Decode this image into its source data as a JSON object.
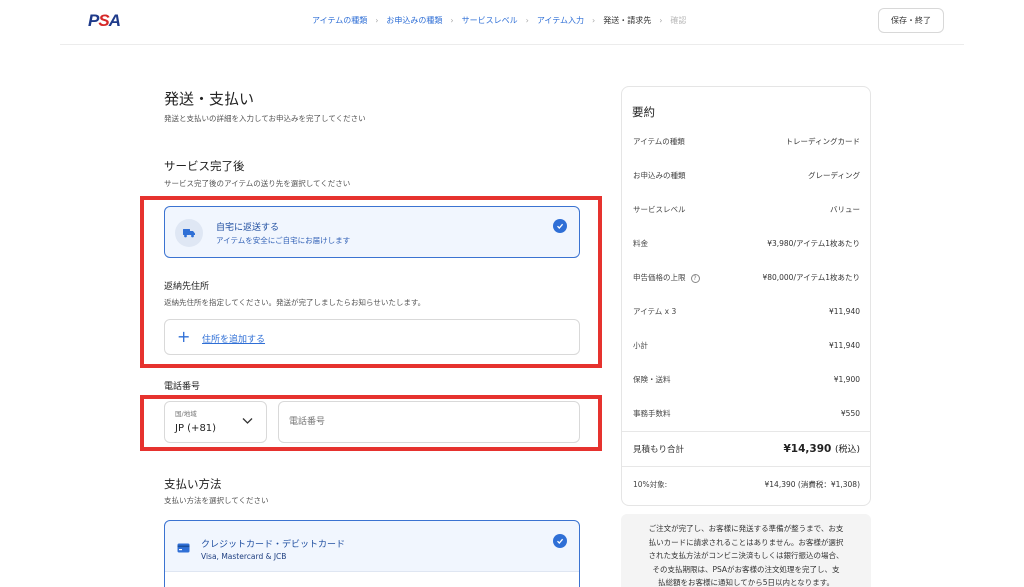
{
  "header": {
    "logo": {
      "p": "P",
      "s": "S",
      "a": "A"
    },
    "breadcrumbs": [
      {
        "label": "アイテムの種類"
      },
      {
        "label": "お申込みの種類"
      },
      {
        "label": "サービスレベル"
      },
      {
        "label": "アイテム入力"
      },
      {
        "label": "発送・請求先"
      },
      {
        "label": "確認"
      }
    ],
    "save_label": "保存・終了"
  },
  "main": {
    "title": "発送・支払い",
    "subtitle": "発送と支払いの詳細を入力してお申込みを完了してください",
    "service_section": {
      "title": "サービス完了後",
      "subtitle": "サービス完了後のアイテムの送り先を選択してください",
      "option": {
        "title": "自宅に返送する",
        "subtitle": "アイテムを安全にご自宅にお届けします",
        "icon": "truck-icon"
      }
    },
    "return_address": {
      "title": "返納先住所",
      "subtitle": "返納先住所を指定してください。発送が完了しましたらお知らせいたします。",
      "add_label": "住所を追加する"
    },
    "phone": {
      "label": "電話番号",
      "country_label": "国/地域",
      "country_value": "JP (+81)",
      "placeholder": "電話番号"
    },
    "payment_section": {
      "title": "支払い方法",
      "subtitle": "支払い方法を選択してください",
      "option": {
        "title": "クレジットカード・デビットカード",
        "subtitle": "Visa, Mastercard & JCB",
        "icon": "credit-card-icon"
      }
    }
  },
  "summary": {
    "title": "要約",
    "rows": [
      {
        "label": "アイテムの種類",
        "value": "トレーディングカード"
      },
      {
        "label": "お申込みの種類",
        "value": "グレーディング"
      },
      {
        "label": "サービスレベル",
        "value": "バリュー"
      },
      {
        "label": "料金",
        "value": "¥3,980/アイテム1枚あたり"
      },
      {
        "label": "申告価格の上限",
        "value": "¥80,000/アイテム1枚あたり"
      },
      {
        "label": "アイテム x 3",
        "value": "¥11,940"
      },
      {
        "label": "小計",
        "value": "¥11,940"
      },
      {
        "label": "保険・送料",
        "value": "¥1,900"
      },
      {
        "label": "事務手数料",
        "value": "¥550"
      }
    ],
    "total": {
      "label": "見積もり合計",
      "amount": "¥14,390",
      "tax_note": "(税込)"
    },
    "tax_row": {
      "label": "10%対象:",
      "value": "¥14,390 (消費税：¥1,308)"
    },
    "notice_lines": [
      "ご注文が完了し、お客様に発送する準備が整うまで、お支",
      "払いカードに請求されることはありません。お客様が選択",
      "された支払方法がコンビニ決済もしくは銀行振込の場合、",
      "その支払期限は、PSAがお客様の注文処理を完了し、支",
      "払総額をお客様に通知してから5日以内となります。"
    ]
  },
  "colors": {
    "accent": "#2f6fd6",
    "highlight_border": "#e6322e",
    "selected_bg": "#f1f6fe"
  }
}
